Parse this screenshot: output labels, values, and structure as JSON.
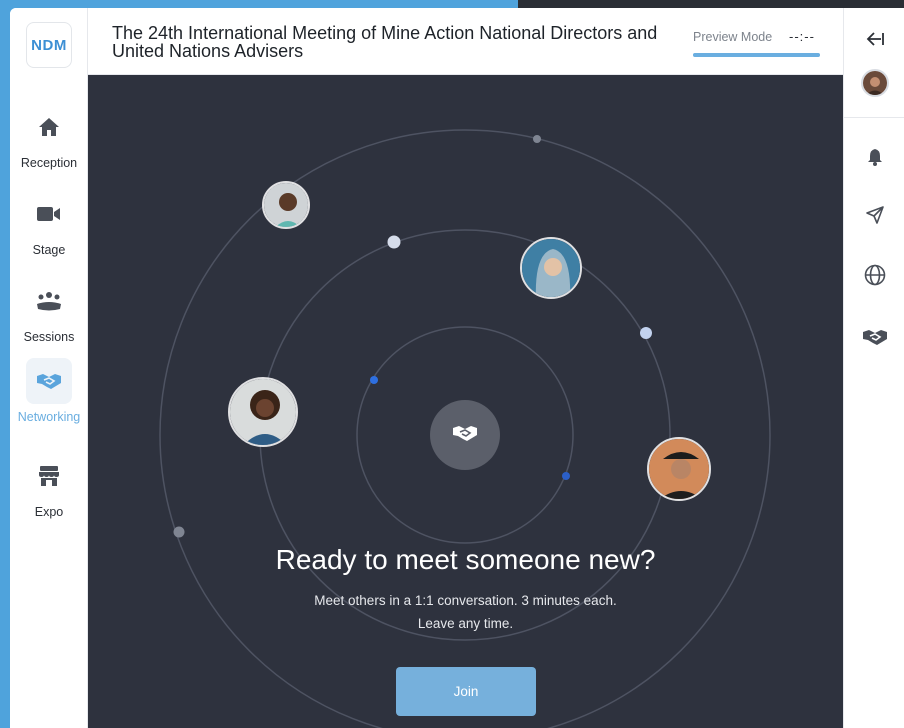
{
  "app": {
    "logo_text": "NDM",
    "event_title": "The 24th International Meeting of Mine Action National Directors and United Nations Advisers",
    "preview_label": "Preview Mode",
    "timer": "--:--",
    "preview_progress": 1.0,
    "accent_color": "#6aaee0"
  },
  "sidebar": {
    "items": [
      {
        "label": "Reception",
        "icon": "home-icon",
        "active": false
      },
      {
        "label": "Stage",
        "icon": "video-camera-icon",
        "active": false
      },
      {
        "label": "Sessions",
        "icon": "people-group-icon",
        "active": false
      },
      {
        "label": "Networking",
        "icon": "handshake-icon",
        "active": true
      },
      {
        "label": "Expo",
        "icon": "storefront-icon",
        "active": false
      }
    ]
  },
  "networking": {
    "headline": "Ready to meet someone new?",
    "subline_1": "Meet others in a 1:1 conversation. 3 minutes each.",
    "subline_2": "Leave any time.",
    "join_label": "Join",
    "center_icon": "handshake-icon"
  },
  "right_sidebar": {
    "items": [
      "collapse-panel-icon",
      "user-avatar",
      "bell-icon",
      "send-icon",
      "globe-icon",
      "handshake-icon"
    ]
  }
}
